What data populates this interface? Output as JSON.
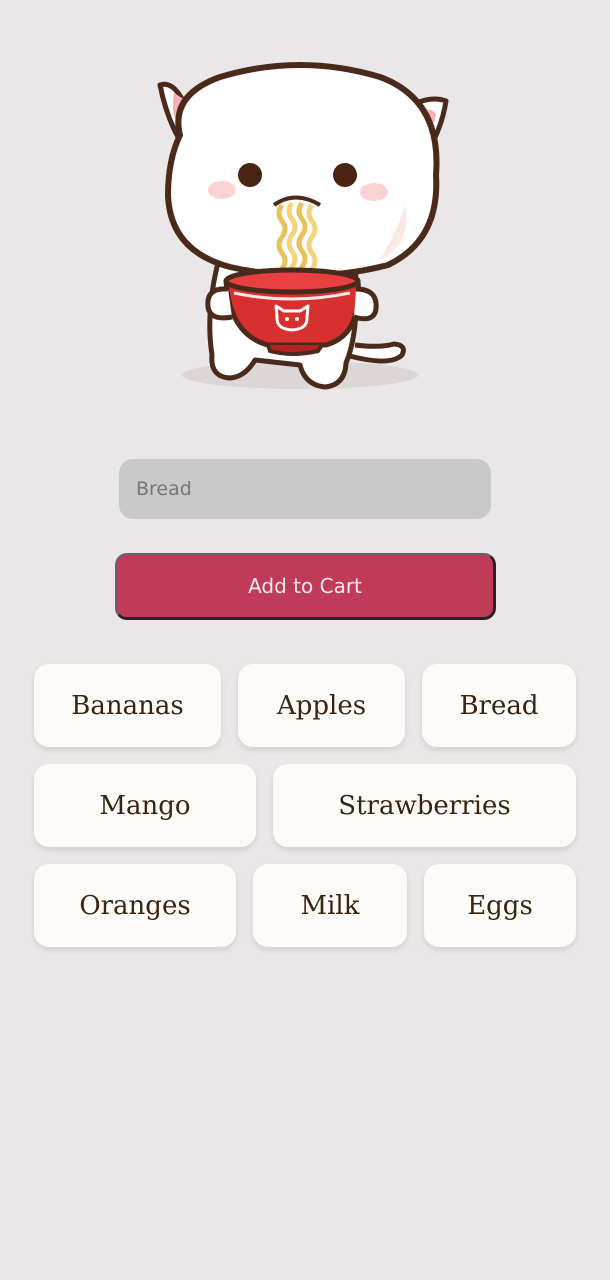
{
  "input": {
    "placeholder": "Bread"
  },
  "add_button": {
    "label": "Add to Cart"
  },
  "items": [
    {
      "label": "Bananas"
    },
    {
      "label": "Apples"
    },
    {
      "label": "Bread"
    },
    {
      "label": "Mango"
    },
    {
      "label": "Strawberries"
    },
    {
      "label": "Oranges"
    },
    {
      "label": "Milk"
    },
    {
      "label": "Eggs"
    }
  ],
  "colors": {
    "background": "#eae7e8",
    "button": "#bf3b58",
    "input": "#c9c9c9",
    "chip": "#fcfbf7",
    "chip_text": "#3a2410"
  },
  "mascot_icon": "cat-eating-ramen-icon"
}
